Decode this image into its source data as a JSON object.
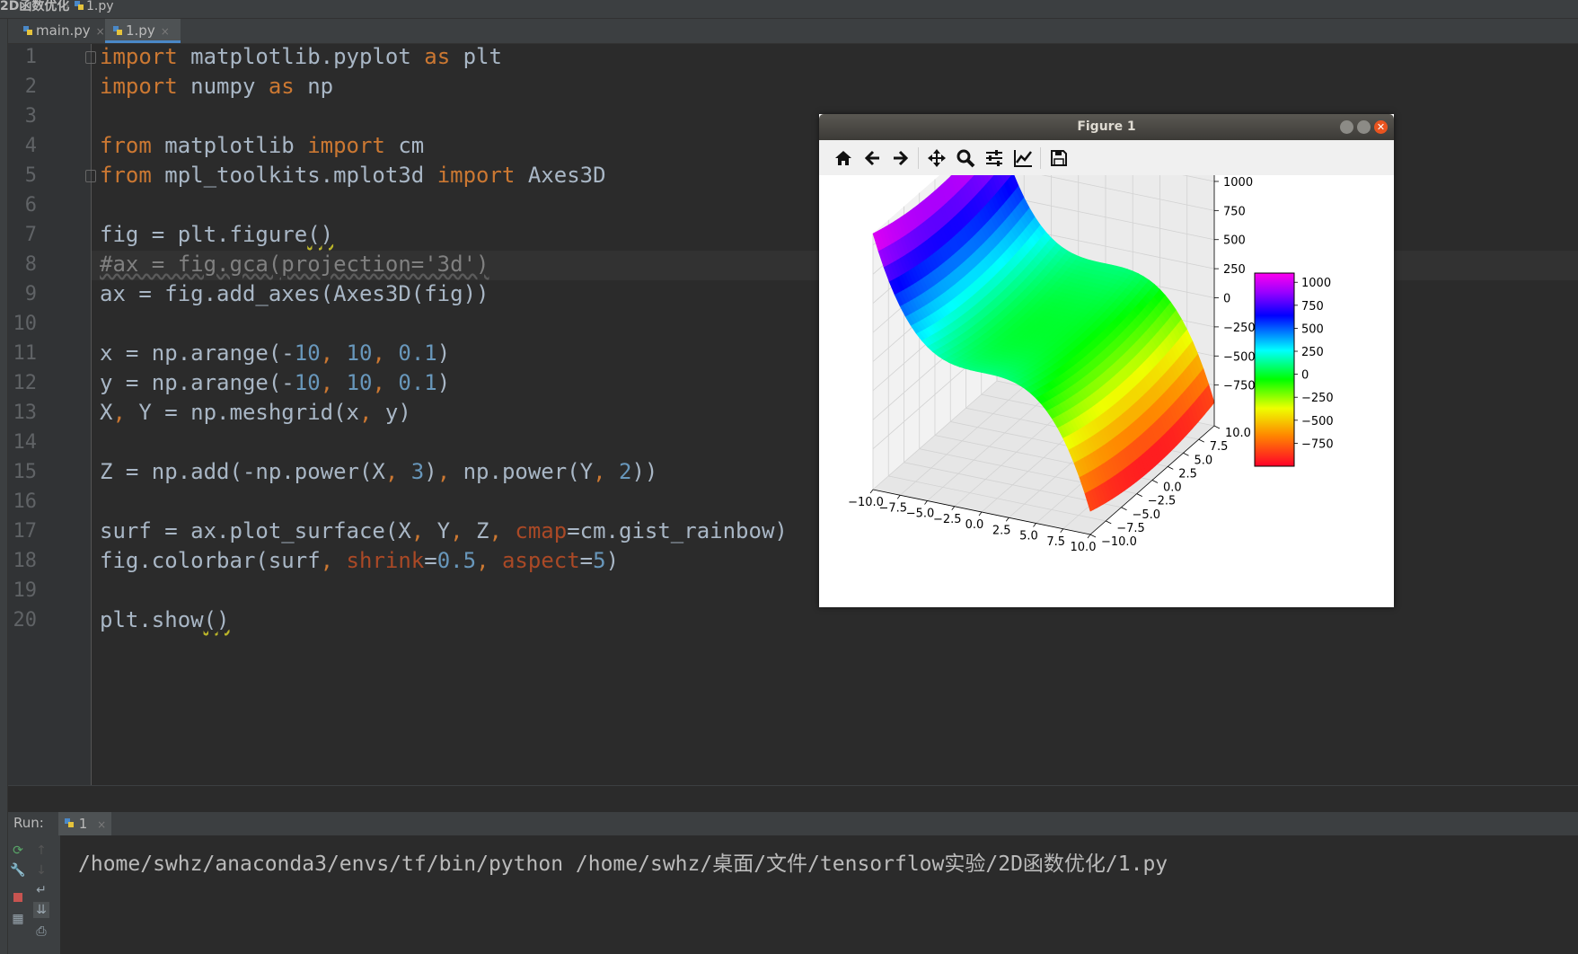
{
  "breadcrumb": {
    "project": "2D函数优化",
    "file": "1.py"
  },
  "tabs": [
    {
      "label": "main.py",
      "active": false
    },
    {
      "label": "1.py",
      "active": true
    }
  ],
  "line_numbers": [
    "1",
    "2",
    "3",
    "4",
    "5",
    "6",
    "7",
    "8",
    "9",
    "10",
    "11",
    "12",
    "13",
    "14",
    "15",
    "16",
    "17",
    "18",
    "19",
    "20"
  ],
  "code_lines": [
    "import matplotlib.pyplot as plt",
    "import numpy as np",
    "",
    "from matplotlib import cm",
    "from mpl_toolkits.mplot3d import Axes3D",
    "",
    "fig = plt.figure()",
    "#ax = fig.gca(projection='3d')",
    "ax = fig.add_axes(Axes3D(fig))",
    "",
    "x = np.arange(-10, 10, 0.1)",
    "y = np.arange(-10, 10, 0.1)",
    "X, Y = np.meshgrid(x, y)",
    "",
    "Z = np.add(-np.power(X, 3), np.power(Y, 2))",
    "",
    "surf = ax.plot_surface(X, Y, Z, cmap=cm.gist_rainbow)",
    "fig.colorbar(surf, shrink=0.5, aspect=5)",
    "",
    "plt.show()"
  ],
  "run": {
    "label": "Run:",
    "tab": "1",
    "command": "/home/swhz/anaconda3/envs/tf/bin/python /home/swhz/桌面/文件/tensorflow实验/2D函数优化/1.py"
  },
  "figure": {
    "window_title": "Figure 1",
    "toolbar": [
      "home-icon",
      "back-icon",
      "forward-icon",
      "pan-icon",
      "zoom-icon",
      "configure-subplots-icon",
      "edit-axes-icon",
      "save-icon"
    ],
    "colors": {
      "title_bar": "#3c3b37",
      "close": "#e9541f"
    }
  },
  "chart_data": {
    "type": "surface3d",
    "function": "Z = -X^3 + Y^2",
    "colormap": "gist_rainbow",
    "x_ticks": [
      "−10.0",
      "−7.5",
      "−5.0",
      "−2.5",
      "0.0",
      "2.5",
      "5.0",
      "7.5",
      "10.0"
    ],
    "y_ticks": [
      "−10.0",
      "−7.5",
      "−5.0",
      "−2.5",
      "0.0",
      "2.5",
      "5.0",
      "7.5",
      "10.0"
    ],
    "z_ticks": [
      "1000",
      "750",
      "500",
      "250",
      "0",
      "−250",
      "−500",
      "−750"
    ],
    "colorbar_ticks": [
      "1000",
      "750",
      "500",
      "250",
      "0",
      "−250",
      "−500",
      "−750"
    ],
    "xlim": [
      -10,
      10
    ],
    "ylim": [
      -10,
      10
    ],
    "zlim": [
      -1100,
      1100
    ],
    "grid": true,
    "legend": "colorbar-right"
  }
}
